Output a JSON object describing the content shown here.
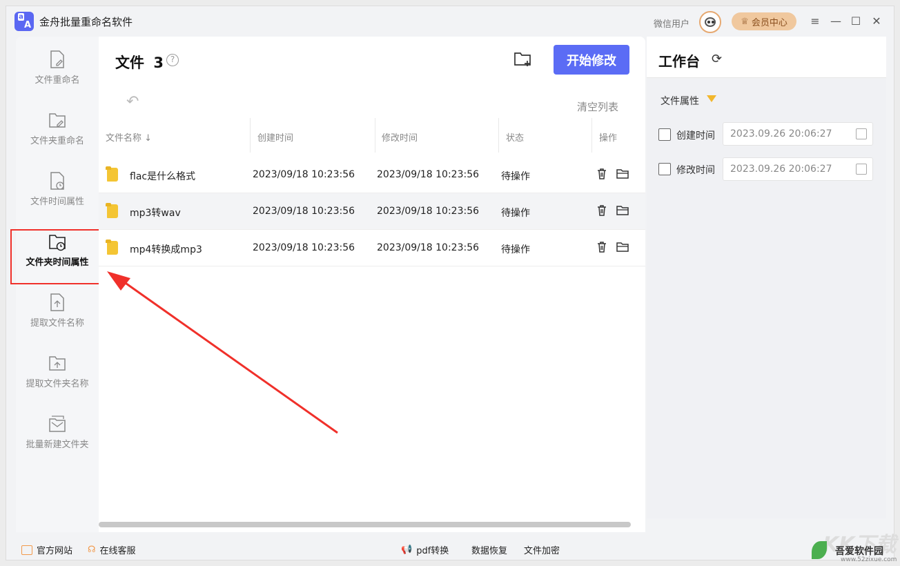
{
  "app": {
    "title": "金舟批量重命名软件",
    "user_label": "微信用户",
    "vip_label": "会员中心"
  },
  "sidebar": {
    "items": [
      {
        "label": "文件重命名",
        "icon": "file-edit-icon"
      },
      {
        "label": "文件夹重命名",
        "icon": "folder-edit-icon"
      },
      {
        "label": "文件时间属性",
        "icon": "file-clock-icon"
      },
      {
        "label": "文件夹时间属性",
        "icon": "folder-clock-icon",
        "active": true
      },
      {
        "label": "提取文件名称",
        "icon": "file-upload-icon"
      },
      {
        "label": "提取文件夹名称",
        "icon": "folder-upload-icon"
      },
      {
        "label": "批量新建文件夹",
        "icon": "folder-batch-icon"
      }
    ]
  },
  "main": {
    "files_label": "文件",
    "files_count": "3",
    "start_button": "开始修改",
    "clear_list": "清空列表",
    "columns": [
      "文件名称",
      "创建时间",
      "修改时间",
      "状态",
      "操作"
    ],
    "rows": [
      {
        "name": "flac是什么格式",
        "created": "2023/09/18 10:23:56",
        "modified": "2023/09/18 10:23:56",
        "status": "待操作"
      },
      {
        "name": "mp3转wav",
        "created": "2023/09/18 10:23:56",
        "modified": "2023/09/18 10:23:56",
        "status": "待操作"
      },
      {
        "name": "mp4转换成mp3",
        "created": "2023/09/18 10:23:56",
        "modified": "2023/09/18 10:23:56",
        "status": "待操作"
      }
    ]
  },
  "workbench": {
    "title": "工作台",
    "attr_label": "文件属性",
    "fields": [
      {
        "label": "创建时间",
        "value": "2023.09.26 20:06:27"
      },
      {
        "label": "修改时间",
        "value": "2023.09.26 20:06:27"
      }
    ]
  },
  "bottom": {
    "website": "官方网站",
    "support": "在线客服",
    "pdf": "pdf转换",
    "recovery": "数据恢复",
    "encrypt": "文件加密"
  },
  "watermark": {
    "text1": "KK下载",
    "text2": "吾爱软件园",
    "text3": "www.52zixue.com"
  },
  "colors": {
    "accent": "#5b6cf5",
    "highlight": "#f0302a",
    "vip": "#f0c89e",
    "folder": "#f4c534"
  }
}
